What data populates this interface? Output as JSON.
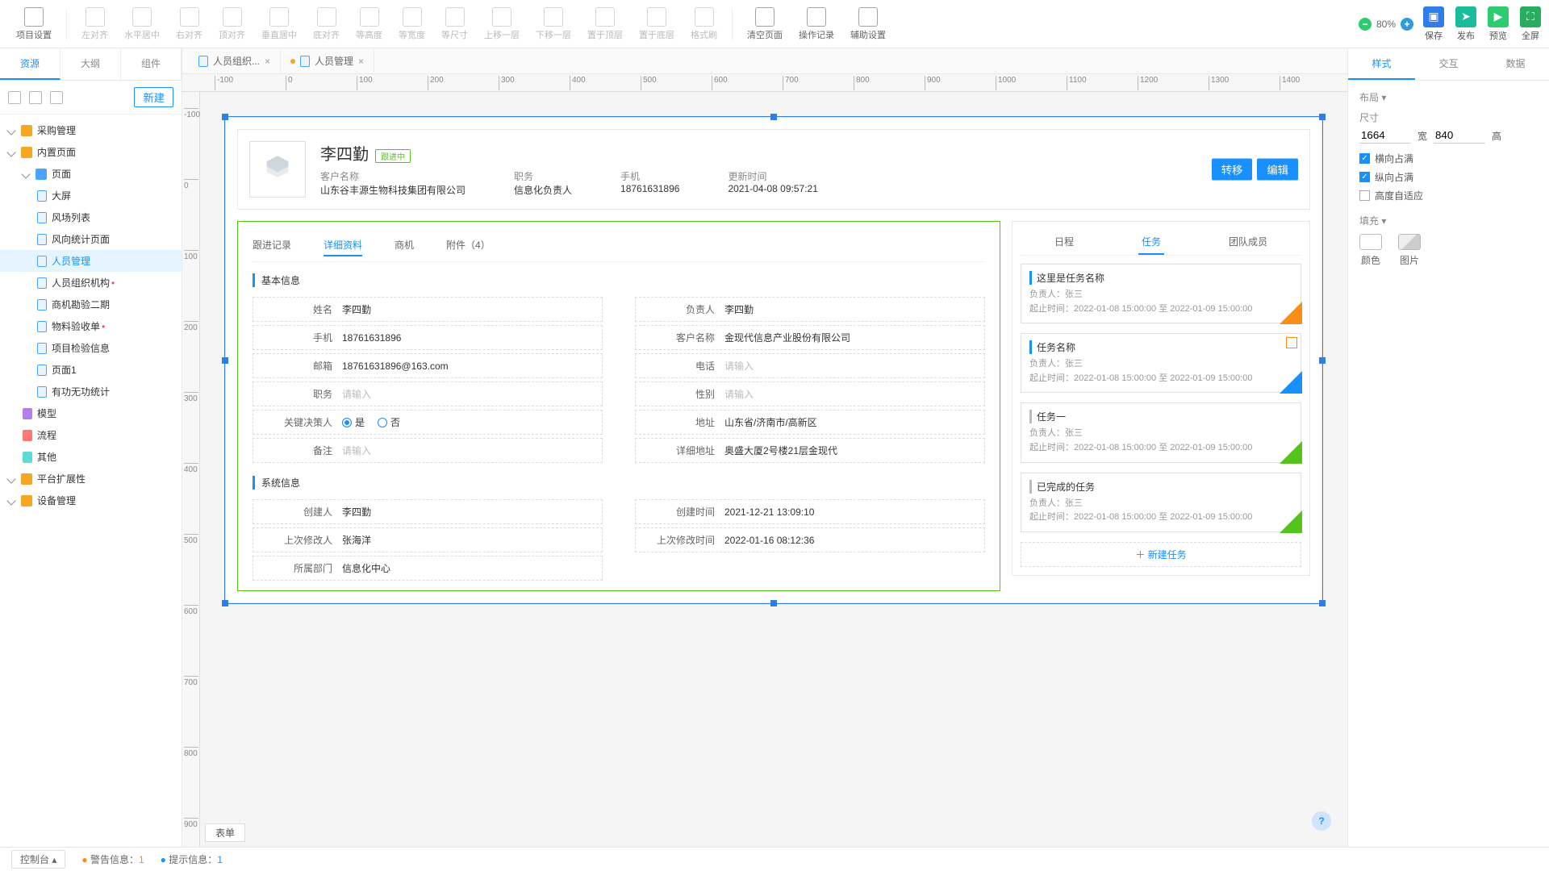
{
  "topbar": {
    "project": "项目设置",
    "align": [
      "左对齐",
      "水平居中",
      "右对齐",
      "顶对齐",
      "垂直居中",
      "底对齐",
      "等高度",
      "等宽度",
      "等尺寸",
      "上移一层",
      "下移一层",
      "置于顶层",
      "置于底层",
      "格式刷"
    ],
    "ops": [
      "清空页面",
      "操作记录",
      "辅助设置"
    ],
    "zoom": "80%",
    "actions": [
      "保存",
      "发布",
      "预览",
      "全屏"
    ]
  },
  "leftTabs": [
    "资源",
    "大纲",
    "组件"
  ],
  "newBtn": "新建",
  "tree": [
    {
      "lvl": 0,
      "ico": "cube",
      "label": "采购管理",
      "exp": true
    },
    {
      "lvl": 0,
      "ico": "cube",
      "label": "内置页面",
      "exp": true
    },
    {
      "lvl": 1,
      "ico": "fold",
      "label": "页面",
      "exp": true
    },
    {
      "lvl": 2,
      "ico": "page",
      "label": "大屏"
    },
    {
      "lvl": 2,
      "ico": "page",
      "label": "风场列表"
    },
    {
      "lvl": 2,
      "ico": "page",
      "label": "风向统计页面"
    },
    {
      "lvl": 2,
      "ico": "page",
      "label": "人员管理",
      "sel": true
    },
    {
      "lvl": 2,
      "ico": "page",
      "label": "人员组织机构",
      "red": true
    },
    {
      "lvl": 2,
      "ico": "page",
      "label": "商机勘验二期"
    },
    {
      "lvl": 2,
      "ico": "page",
      "label": "物料验收单",
      "red": true
    },
    {
      "lvl": 2,
      "ico": "page",
      "label": "项目检验信息"
    },
    {
      "lvl": 2,
      "ico": "page",
      "label": "页面1"
    },
    {
      "lvl": 2,
      "ico": "page",
      "label": "有功无功统计"
    },
    {
      "lvl": 1,
      "ico": "model",
      "label": "模型"
    },
    {
      "lvl": 1,
      "ico": "flow",
      "label": "流程"
    },
    {
      "lvl": 1,
      "ico": "other",
      "label": "其他"
    },
    {
      "lvl": 0,
      "ico": "cube",
      "label": "平台扩展性",
      "exp": true
    },
    {
      "lvl": 0,
      "ico": "cube",
      "label": "设备管理",
      "exp": true
    }
  ],
  "fileTabs": [
    {
      "label": "人员组织...",
      "dirty": false
    },
    {
      "label": "人员管理",
      "dirty": true
    }
  ],
  "head": {
    "name": "李四勤",
    "tag": "跟进中",
    "rows": [
      {
        "k": "客户名称",
        "v": "山东谷丰源生物科技集团有限公司",
        "link": true
      },
      {
        "k": "职务",
        "v": "信息化负责人"
      },
      {
        "k": "手机",
        "v": "18761631896"
      },
      {
        "k": "更新时间",
        "v": "2021-04-08 09:57:21"
      }
    ],
    "btns": [
      "转移",
      "编辑"
    ]
  },
  "detailTabs": [
    "跟进记录",
    "详细资料",
    "商机",
    "附件（4）"
  ],
  "sect1": "基本信息",
  "sect2": "系统信息",
  "fieldsL": [
    {
      "l": "姓名",
      "v": "李四勤"
    },
    {
      "l": "手机",
      "v": "18761631896"
    },
    {
      "l": "邮箱",
      "v": "18761631896@163.com"
    },
    {
      "l": "职务",
      "ph": "请输入"
    },
    {
      "l": "关键决策人",
      "radio": true,
      "opts": [
        "是",
        "否"
      ],
      "val": "是"
    },
    {
      "l": "备注",
      "ph": "请输入"
    }
  ],
  "fieldsR": [
    {
      "l": "负责人",
      "v": "李四勤"
    },
    {
      "l": "客户名称",
      "v": "金现代信息产业股份有限公司"
    },
    {
      "l": "电话",
      "ph": "请输入"
    },
    {
      "l": "性别",
      "ph": "请输入"
    },
    {
      "l": "地址",
      "v": "山东省/济南市/高新区"
    },
    {
      "l": "详细地址",
      "v": "奥盛大厦2号楼21层金现代"
    }
  ],
  "sysL": [
    {
      "l": "创建人",
      "v": "李四勤"
    },
    {
      "l": "上次修改人",
      "v": "张海洋"
    },
    {
      "l": "所属部门",
      "v": "信息化中心"
    }
  ],
  "sysR": [
    {
      "l": "创建时间",
      "v": "2021-12-21 13:09:10"
    },
    {
      "l": "上次修改时间",
      "v": "2022-01-16 08:12:36"
    }
  ],
  "taskTabs": [
    "日程",
    "任务",
    "团队成员"
  ],
  "tasks": [
    {
      "title": "这里是任务名称",
      "owner": "张三",
      "time": "2022-01-08 15:00:00 至 2022-01-09 15:00:00",
      "ribbon": "orange",
      "bar": "blue"
    },
    {
      "title": "任务名称",
      "owner": "张三",
      "time": "2022-01-08 15:00:00 至 2022-01-09 15:00:00",
      "ribbon": "blue",
      "box": true,
      "bar": "blue"
    },
    {
      "title": "任务一",
      "owner": "张三",
      "time": "2022-01-08 15:00:00 至 2022-01-09 15:00:00",
      "ribbon": "green",
      "bar": "gray"
    },
    {
      "title": "已完成的任务",
      "owner": "张三",
      "time": "2022-01-08 15:00:00 至 2022-01-09 15:00:00",
      "ribbon": "green",
      "bar": "gray"
    }
  ],
  "taskMeta": {
    "ownerLabel": "负责人：",
    "timeLabel": "起止时间："
  },
  "addTask": "新建任务",
  "rightTabs": [
    "样式",
    "交互",
    "数据"
  ],
  "rp": {
    "layout": "布局",
    "size": "尺寸",
    "w": "1664",
    "h": "840",
    "wl": "宽",
    "hl": "高",
    "chk1": "横向占满",
    "chk2": "纵向占满",
    "chk3": "高度自适应",
    "fill": "填充",
    "color": "颜色",
    "image": "图片"
  },
  "bottom": {
    "form": "表单",
    "console": "控制台",
    "warn": "警告信息：",
    "warnN": "1",
    "info": "提示信息：",
    "infoN": "1"
  }
}
